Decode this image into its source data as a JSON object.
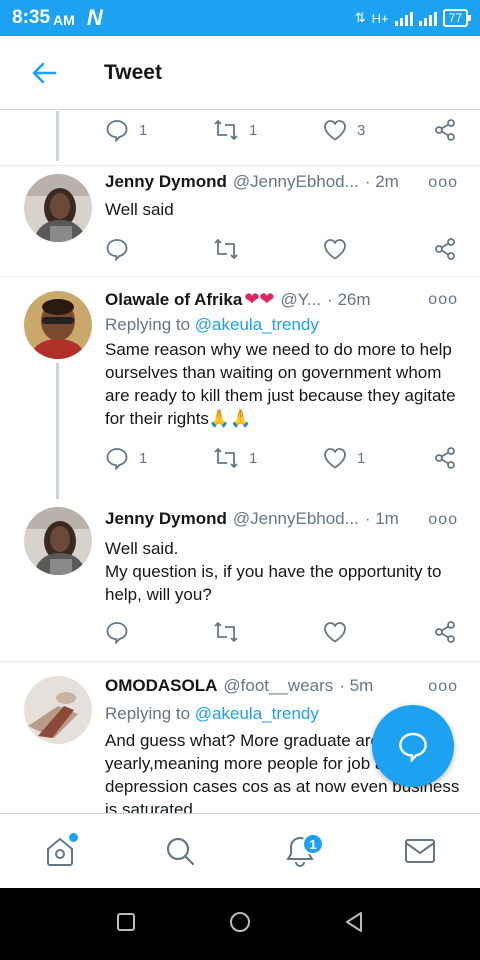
{
  "status_bar": {
    "time": "8:35",
    "ampm": "AM",
    "carrier_logo": "N",
    "network": "H+",
    "battery": "77"
  },
  "header": {
    "title": "Tweet"
  },
  "top_actions": {
    "reply_count": "1",
    "retweet_count": "1",
    "like_count": "3"
  },
  "tweets": [
    {
      "name": "Jenny Dymond",
      "handle": "@JennyEbhod...",
      "time": "· 2m",
      "body": "Well said",
      "reply_count": "",
      "retweet_count": "",
      "like_count": ""
    },
    {
      "name": "Olawale of Afrika",
      "name_emoji": "❤❤",
      "handle": "@Y...",
      "time": "· 26m",
      "replying_label": "Replying to",
      "replying_to": "@akeula_trendy",
      "body": "Same reason why we need to do more to help ourselves than waiting on government whom are ready to kill them just because they agitate for their rights🙏🙏",
      "reply_count": "1",
      "retweet_count": "1",
      "like_count": "1"
    },
    {
      "name": "Jenny Dymond",
      "handle": "@JennyEbhod...",
      "time": "· 1m",
      "body_line1": "Well said.",
      "body_line2": "My question is, if you have the opportunity to help, will you?",
      "reply_count": "",
      "retweet_count": "",
      "like_count": ""
    },
    {
      "name": "OMODASOLA",
      "handle": "@foot__wears",
      "time": "· 5m",
      "replying_label": "Replying to",
      "replying_to": "@akeula_trendy",
      "body": "And guess what? More graduate are produce yearly,meaning more people for job and more depression cases cos as at now even business is saturated"
    }
  ],
  "bottom_nav": {
    "notifications_badge": "1"
  },
  "colors": {
    "accent": "#1da1f2",
    "text": "#14171a",
    "muted": "#657786",
    "heart": "#e0245e"
  }
}
